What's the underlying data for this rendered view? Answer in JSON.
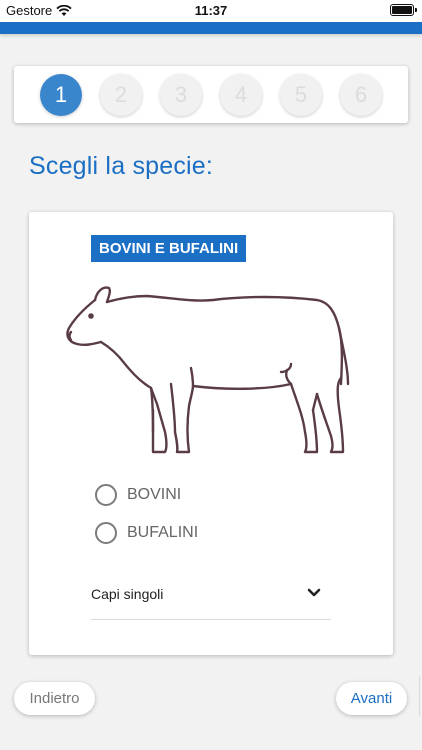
{
  "status_bar": {
    "carrier": "Gestore",
    "time": "11:37"
  },
  "stepper": {
    "steps": [
      "1",
      "2",
      "3",
      "4",
      "5",
      "6"
    ],
    "active_index": 0
  },
  "page": {
    "title": "Scegli la specie:"
  },
  "species_card": {
    "badge": "BOVINI E BUFALINI",
    "options": [
      "BOVINI",
      "BUFALINI"
    ],
    "select_value": "Capi singoli"
  },
  "footer": {
    "back_label": "Indietro",
    "next_label": "Avanti"
  },
  "colors": {
    "primary": "#1b6fc4",
    "active_step": "#3a86cc",
    "background": "#f2f2f2",
    "cow_outline": "#5a3b48"
  },
  "icons": [
    "wifi-icon",
    "battery-icon",
    "cow-icon",
    "chevron-down-icon"
  ]
}
